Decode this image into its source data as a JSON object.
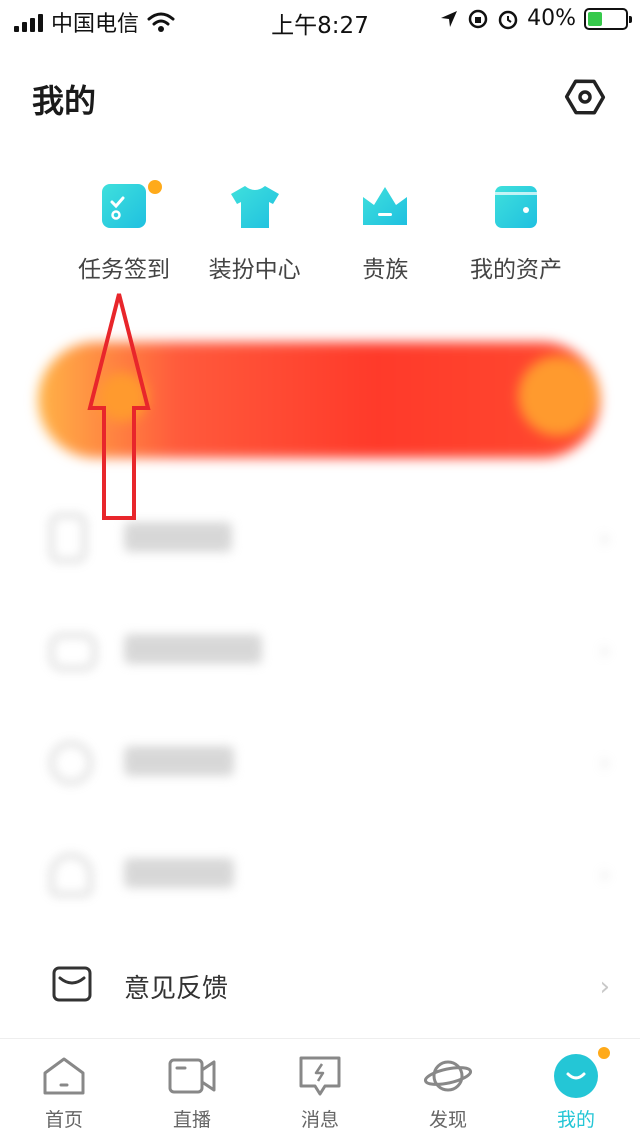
{
  "status_bar": {
    "carrier": "中国电信",
    "time": "上午8:27",
    "battery": "40%"
  },
  "header": {
    "title": "我的",
    "settings_icon": "settings-hexagon-icon"
  },
  "quick_actions": [
    {
      "label": "任务签到",
      "icon": "task-checkin-icon",
      "has_badge": true
    },
    {
      "label": "装扮中心",
      "icon": "tshirt-icon",
      "has_badge": false
    },
    {
      "label": "贵族",
      "icon": "crown-icon",
      "has_badge": false
    },
    {
      "label": "我的资产",
      "icon": "wallet-icon",
      "has_badge": false
    }
  ],
  "menu": {
    "feedback_label": "意见反馈"
  },
  "tabbar": [
    {
      "label": "首页",
      "icon": "home-icon",
      "active": false
    },
    {
      "label": "直播",
      "icon": "video-camera-icon",
      "active": false
    },
    {
      "label": "消息",
      "icon": "message-icon",
      "active": false
    },
    {
      "label": "发现",
      "icon": "planet-icon",
      "active": false
    },
    {
      "label": "我的",
      "icon": "profile-face-icon",
      "active": true
    }
  ],
  "colors": {
    "accent": "#24c6d6",
    "badge": "#ffaa1a",
    "annotation": "#e8262b"
  }
}
